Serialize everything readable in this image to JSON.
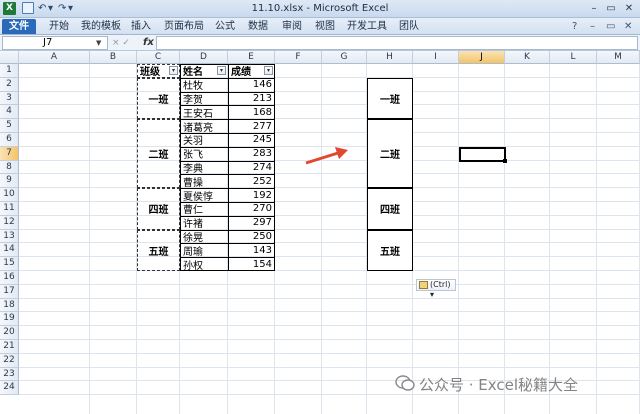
{
  "titlebar": {
    "logo": "X",
    "title": "11.10.xlsx - Microsoft Excel",
    "undo_glyph": "↶",
    "redo_glyph": "↷",
    "dropdown_glyph": "▾",
    "minimize": "–",
    "restore": "▭",
    "close": "✕"
  },
  "ribbon": {
    "tabs": [
      "文件",
      "开始",
      "我的模板",
      "插入",
      "页面布局",
      "公式",
      "数据",
      "审阅",
      "视图",
      "开发工具",
      "团队"
    ],
    "help_glyph": "?",
    "min_glyph": "–",
    "restore_glyph": "▭",
    "close_glyph": "✕"
  },
  "formula_bar": {
    "name_box": "J7",
    "fx": "fx",
    "sep": "×  ✓",
    "value": ""
  },
  "columns": [
    "A",
    "B",
    "C",
    "D",
    "E",
    "F",
    "G",
    "H",
    "I",
    "J",
    "K",
    "L",
    "M"
  ],
  "rows": [
    "1",
    "2",
    "3",
    "4",
    "5",
    "6",
    "7",
    "8",
    "9",
    "10",
    "11",
    "12",
    "13",
    "14",
    "15",
    "16",
    "17",
    "18",
    "19",
    "20",
    "21",
    "22",
    "23",
    "24"
  ],
  "table": {
    "headers": {
      "class": "班级",
      "name": "姓名",
      "score": "成绩"
    },
    "class_groups": [
      "一班",
      "二班",
      "四班",
      "五班"
    ],
    "students": [
      {
        "name": "杜牧",
        "score": "146"
      },
      {
        "name": "李贺",
        "score": "213"
      },
      {
        "name": "王安石",
        "score": "168"
      },
      {
        "name": "诸葛亮",
        "score": "277"
      },
      {
        "name": "关羽",
        "score": "245"
      },
      {
        "name": "张飞",
        "score": "283"
      },
      {
        "name": "李典",
        "score": "274"
      },
      {
        "name": "曹操",
        "score": "252"
      },
      {
        "name": "夏侯惇",
        "score": "192"
      },
      {
        "name": "曹仁",
        "score": "270"
      },
      {
        "name": "许褚",
        "score": "297"
      },
      {
        "name": "徐晃",
        "score": "250"
      },
      {
        "name": "周瑜",
        "score": "143"
      },
      {
        "name": "孙权",
        "score": "154"
      }
    ],
    "filter_glyph": "▾"
  },
  "pasted_groups": [
    "一班",
    "二班",
    "四班",
    "五班"
  ],
  "paste_options_label": "(Ctrl)",
  "paste_options_arrow": "▾",
  "watermark": "公众号 · Excel秘籍大全",
  "colors": {
    "arrow": "#e2472f",
    "file_tab": "#2a6ab8",
    "selection": "#f3c46a"
  }
}
